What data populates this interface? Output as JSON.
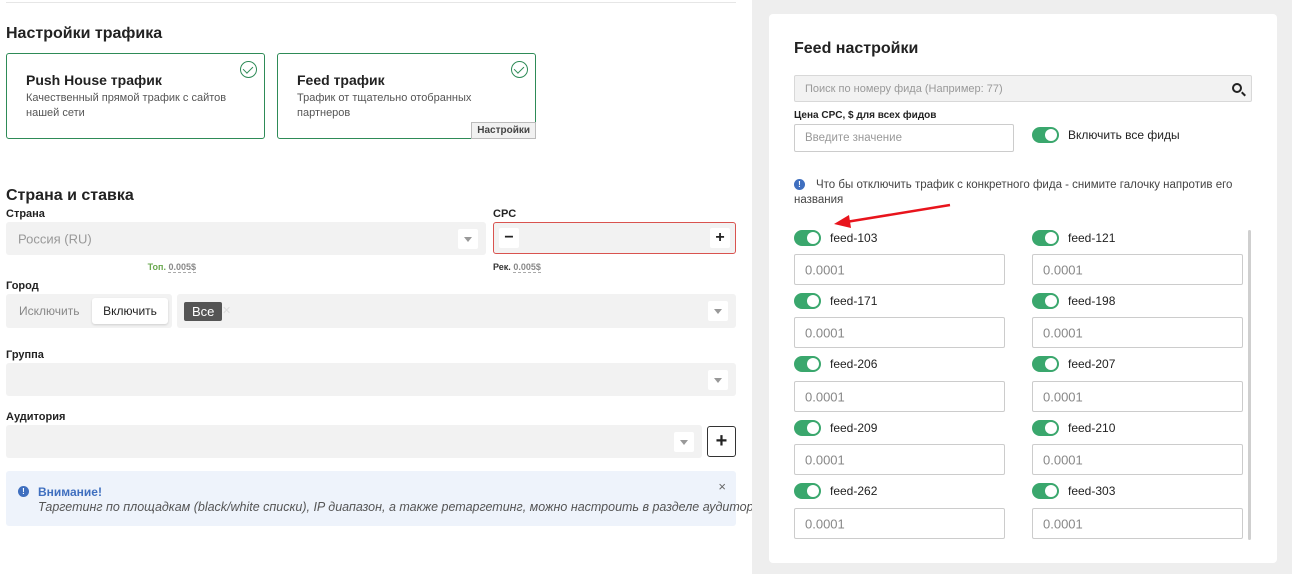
{
  "traffic": {
    "heading": "Настройки трафика",
    "cards": [
      {
        "title": "Push House трафик",
        "desc": "Качественный прямой трафик с сайтов нашей сети"
      },
      {
        "title": "Feed трафик",
        "desc": "Трафик от тщательно отобранных партнеров",
        "settings_label": "Настройки"
      }
    ]
  },
  "country_rate": {
    "heading": "Страна и ставка",
    "country_label": "Страна",
    "country_value": "Россия (RU)",
    "cpc_label": "CPC",
    "cpc_minus": "−",
    "cpc_plus": "+",
    "rec_label": "Рек.",
    "rec_value": "0.005$",
    "top_label": "Топ.",
    "top_value": "0.005$",
    "city_label": "Город",
    "exclude_label": "Исключить",
    "include_label": "Включить",
    "city_tag": "Все",
    "group_label": "Группа",
    "audience_label": "Аудитория",
    "add_audience": "+"
  },
  "alert": {
    "title": "Внимание!",
    "text": "Таргетинг по площадкам (black/white списки), IP диапазон, а также ретаргетинг, можно настроить в разделе аудиторий",
    "close": "×"
  },
  "feed_settings": {
    "heading": "Feed настройки",
    "search_placeholder": "Поиск по номеру фида (Например: 77)",
    "cpc_all_label": "Цена CPC, $ для всех фидов",
    "cpc_all_placeholder": "Введите значение",
    "enable_all_label": "Включить все фиды",
    "hint": "Что бы отключить трафик с конкретного фида - снимите галочку напротив его названия",
    "feeds": [
      {
        "name": "feed-103",
        "value": "0.0001",
        "enabled": true
      },
      {
        "name": "feed-121",
        "value": "0.0001",
        "enabled": true
      },
      {
        "name": "feed-171",
        "value": "0.0001",
        "enabled": true
      },
      {
        "name": "feed-198",
        "value": "0.0001",
        "enabled": true
      },
      {
        "name": "feed-206",
        "value": "0.0001",
        "enabled": true
      },
      {
        "name": "feed-207",
        "value": "0.0001",
        "enabled": true
      },
      {
        "name": "feed-209",
        "value": "0.0001",
        "enabled": true
      },
      {
        "name": "feed-210",
        "value": "0.0001",
        "enabled": true
      },
      {
        "name": "feed-262",
        "value": "0.0001",
        "enabled": true
      },
      {
        "name": "feed-303",
        "value": "0.0001",
        "enabled": true
      }
    ]
  },
  "colors": {
    "accent_green": "#3aa76d",
    "card_border": "#2e8b57",
    "error_red": "#d9534f",
    "info_blue": "#3f6fbf",
    "annotation_arrow": "#e8141c"
  }
}
